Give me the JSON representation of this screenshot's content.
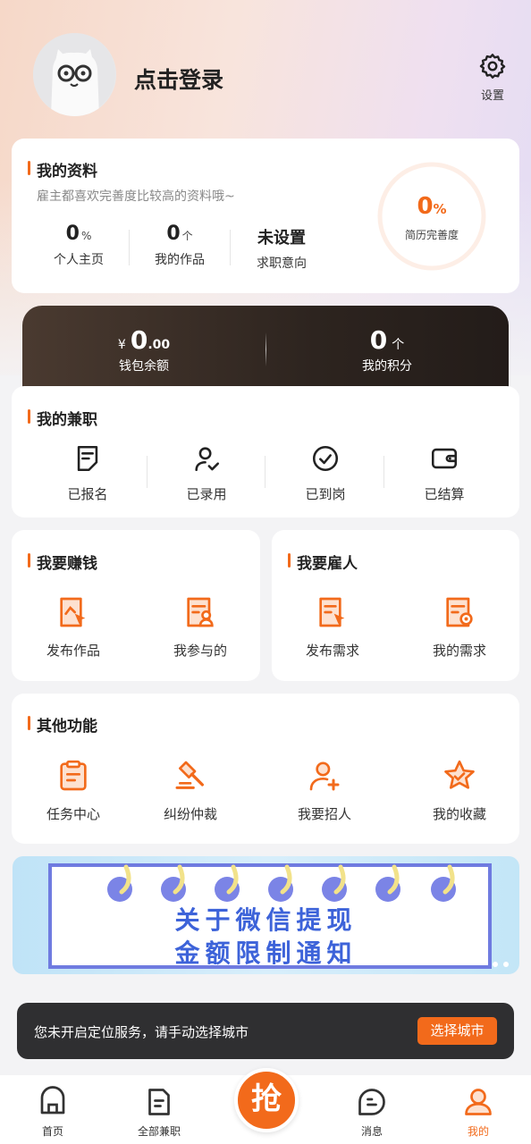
{
  "header": {
    "login_text": "点击登录",
    "settings_label": "设置"
  },
  "profile": {
    "title": "我的资料",
    "subtitle": "雇主都喜欢完善度比较高的资料哦~",
    "stats": [
      {
        "value": "0",
        "unit": "%",
        "label": "个人主页"
      },
      {
        "value": "0",
        "unit": "个",
        "label": "我的作品"
      },
      {
        "value": "未设置",
        "unit": "",
        "label": "求职意向"
      }
    ],
    "completeness": {
      "value": "0",
      "unit": "%",
      "label": "简历完善度",
      "fraction": 0
    }
  },
  "wallet": {
    "currency": "¥",
    "balance_int": "0",
    "balance_dec": ".00",
    "balance_label": "钱包余额",
    "points_value": "0",
    "points_unit": "个",
    "points_label": "我的积分"
  },
  "parttime": {
    "title": "我的兼职",
    "items": [
      {
        "label": "已报名",
        "icon": "signup-doc-icon"
      },
      {
        "label": "已录用",
        "icon": "user-check-icon"
      },
      {
        "label": "已到岗",
        "icon": "check-circle-icon"
      },
      {
        "label": "已结算",
        "icon": "wallet-icon"
      }
    ]
  },
  "earn": {
    "title": "我要赚钱",
    "items": [
      {
        "label": "发布作品",
        "icon": "publish-work-icon"
      },
      {
        "label": "我参与的",
        "icon": "participated-icon"
      }
    ]
  },
  "hire": {
    "title": "我要雇人",
    "items": [
      {
        "label": "发布需求",
        "icon": "publish-demand-icon"
      },
      {
        "label": "我的需求",
        "icon": "my-demand-icon"
      }
    ]
  },
  "other": {
    "title": "其他功能",
    "items": [
      {
        "label": "任务中心",
        "icon": "clipboard-icon"
      },
      {
        "label": "纠纷仲裁",
        "icon": "gavel-icon"
      },
      {
        "label": "我要招人",
        "icon": "add-user-icon"
      },
      {
        "label": "我的收藏",
        "icon": "star-icon"
      }
    ]
  },
  "banner": {
    "line1": "关于微信提现",
    "line2": "金额限制通知"
  },
  "toast": {
    "message": "您未开启定位服务，请手动选择城市",
    "button": "选择城市"
  },
  "tabbar": {
    "items": [
      {
        "label": "首页",
        "icon": "home-icon"
      },
      {
        "label": "全部兼职",
        "icon": "doc-list-icon"
      },
      {
        "label": "消息",
        "icon": "message-icon"
      },
      {
        "label": "我的",
        "icon": "profile-icon",
        "active": true
      }
    ],
    "center_label": "抢"
  },
  "colors": {
    "accent": "#f26a1b",
    "wallet_bg": "#2d241f",
    "banner_text": "#3d63d9"
  }
}
